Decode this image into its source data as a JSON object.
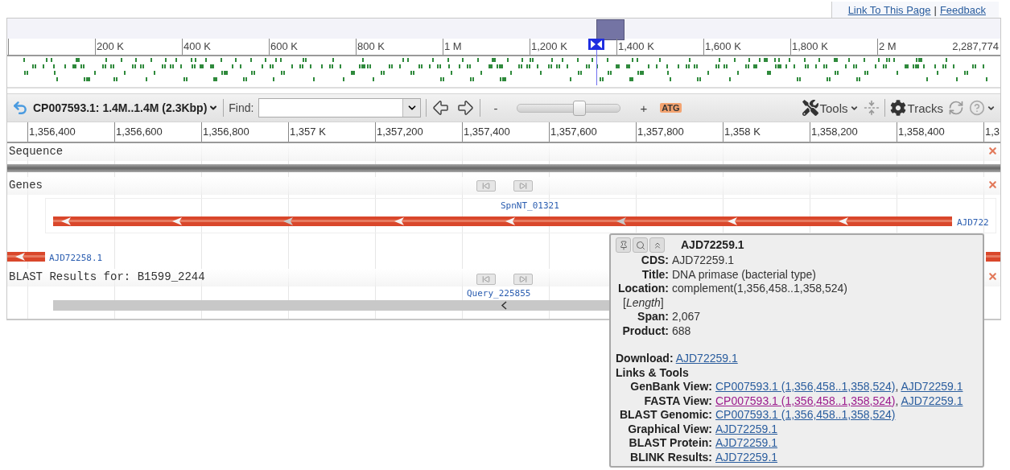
{
  "header_links": {
    "items": [
      {
        "label": "Link To This Page"
      },
      {
        "label": "Feedback"
      }
    ],
    "separator": "|"
  },
  "overview": {
    "ruler": [
      "200 K",
      "400 K",
      "600 K",
      "800 K",
      "1 M",
      "1,200 K",
      "1,400 K",
      "1,600 K",
      "1,800 K",
      "2 M"
    ],
    "end_label": "2,287,774"
  },
  "toolbar": {
    "location": "CP007593.1: 1.4M..1.4M (2.3Kbp)",
    "find_label": "Find:",
    "zoom_out": "-",
    "zoom_in": "+",
    "zoom": {
      "level": 0.6
    },
    "sequence_button": "ATG",
    "tools": "Tools",
    "tracks": "Tracks"
  },
  "ruler": [
    "1,356,400",
    "1,356,600",
    "1,356,800",
    "1,357 K",
    "1,357,200",
    "1,357,400",
    "1,357,600",
    "1,357,800",
    "1,358 K",
    "1,358,200",
    "1,358,400",
    "1,3"
  ],
  "tracks": [
    {
      "kind": "sequence",
      "label": "Sequence"
    },
    {
      "kind": "genes",
      "label": "Genes",
      "group_label": "SpnNT_01321",
      "features": [
        "AJD722",
        "AJD72258.1"
      ]
    },
    {
      "kind": "blast",
      "label": "BLAST Results for: B1599_2244",
      "group_label": "Query_225855"
    }
  ],
  "popup": {
    "title": "AJD72259.1",
    "fields": [
      {
        "label": "CDS:",
        "value": "AJD72259.1"
      },
      {
        "label": "Title:",
        "value": "DNA primase (bacterial type)"
      },
      {
        "label": "Location:",
        "value": "complement(1,356,458..1,358,524)"
      }
    ],
    "note": "[*Length*]",
    "fields2": [
      {
        "label": "Span:",
        "value": "2,067"
      },
      {
        "label": "Product:",
        "value": "688"
      }
    ],
    "download": {
      "label": "Download:",
      "link": "AJD72259.1"
    },
    "section": "Links & Tools",
    "separator": ",",
    "links": [
      {
        "label": "GenBank View:",
        "items": [
          {
            "text": "CP007593.1 (1,356,458..1,358,524)",
            "visited": false
          },
          {
            "text": "AJD72259.1",
            "visited": false
          }
        ]
      },
      {
        "label": "FASTA View:",
        "items": [
          {
            "text": "CP007593.1 (1,356,458..1,358,524)",
            "visited": true
          },
          {
            "text": "AJD72259.1",
            "visited": false
          }
        ]
      },
      {
        "label": "BLAST Genomic:",
        "items": [
          {
            "text": "CP007593.1 (1,356,458..1,358,524)",
            "visited": false
          }
        ]
      },
      {
        "label": "Graphical View:",
        "items": [
          {
            "text": "AJD72259.1",
            "visited": false
          }
        ]
      },
      {
        "label": "BLAST Protein:",
        "items": [
          {
            "text": "AJD72259.1",
            "visited": false
          }
        ]
      },
      {
        "label": "BLINK Results:",
        "items": [
          {
            "text": "AJD72259.1",
            "visited": false
          }
        ]
      }
    ]
  }
}
